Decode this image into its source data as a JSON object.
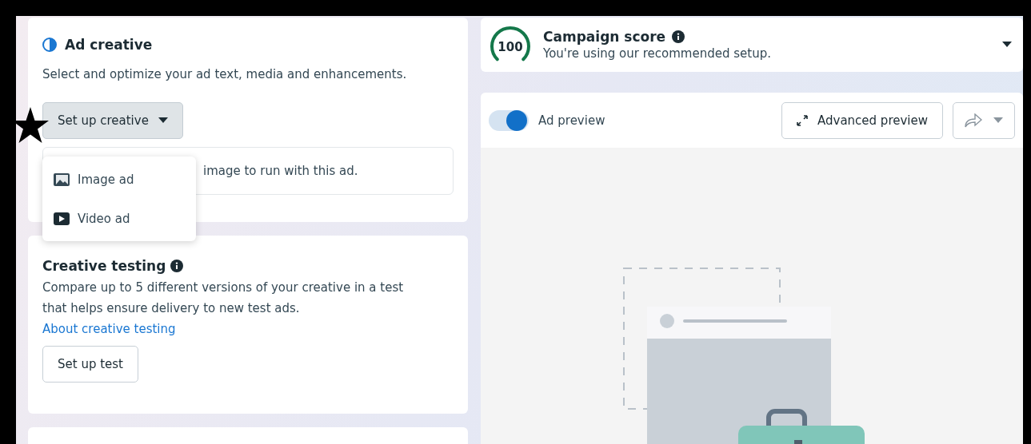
{
  "ad_creative": {
    "title": "Ad creative",
    "description": "Select and optimize your ad text, media and enhancements.",
    "setup_button": {
      "label": "Set up creative",
      "expanded": true
    },
    "menu": [
      {
        "kind": "image",
        "label": "Image ad"
      },
      {
        "kind": "video",
        "label": "Video ad"
      }
    ],
    "hint": "image to run with this ad."
  },
  "creative_testing": {
    "title": "Creative testing",
    "description": "Compare up to 5 different versions of your creative in a test that helps ensure delivery to new test ads.",
    "link": "About creative testing",
    "button": "Set up test"
  },
  "campaign_score": {
    "score": "100",
    "level": 1,
    "title": "Campaign score",
    "subtitle": "You're using our recommended setup."
  },
  "preview": {
    "toggle_label": "Ad preview",
    "toggle_on": true,
    "advanced_button": "Advanced preview"
  }
}
